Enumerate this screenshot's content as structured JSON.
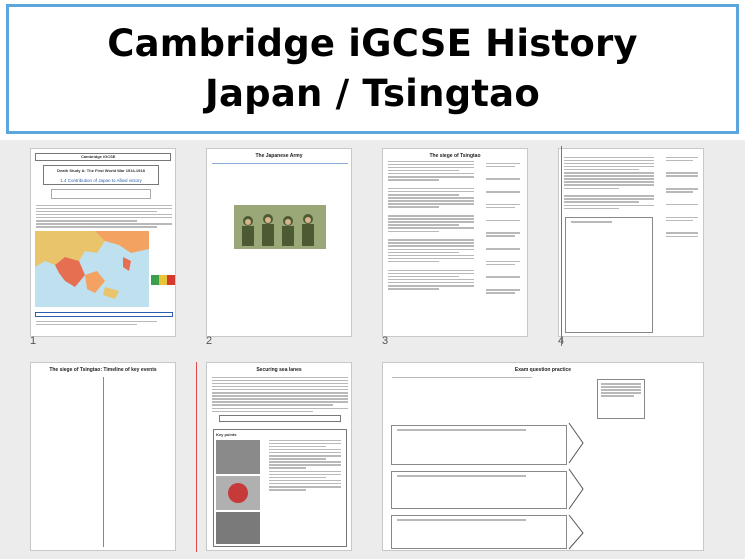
{
  "header": {
    "line1": "Cambridge iGCSE History",
    "line2": "Japan / Tsingtao"
  },
  "colors": {
    "title_border": "#5aa6dd",
    "sorter_background": "#ececec"
  },
  "slides": [
    {
      "number": "1",
      "title": "Cambridge iGCSE",
      "subtitle": "Death Study A: The First World War 1914-1918",
      "heading": "1.4 Contribution of Japan to Allied victory"
    },
    {
      "number": "2",
      "title": "The Japanese Army"
    },
    {
      "number": "3",
      "title": "The siege of Tsingtao"
    },
    {
      "number": "4",
      "title": ""
    },
    {
      "number": "",
      "title": "The siege of Tsingtao: Timeline of key events"
    },
    {
      "number": "",
      "title": "Securing sea lanes",
      "key_label": "Key points"
    },
    {
      "number": "",
      "title": "Exam question practice"
    }
  ]
}
